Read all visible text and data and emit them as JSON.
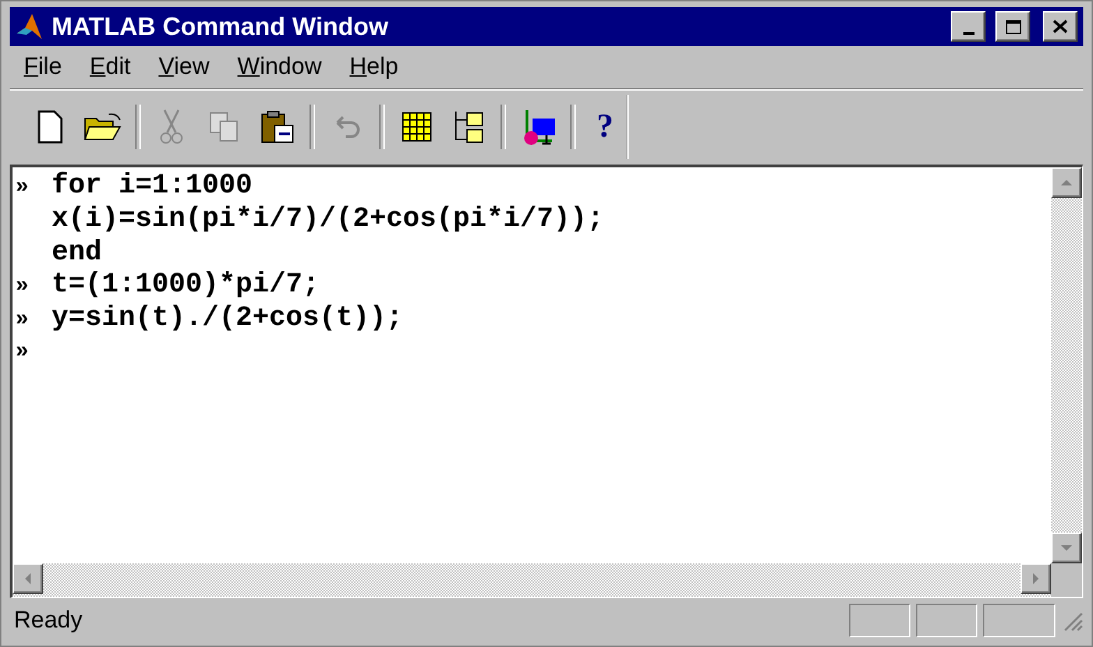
{
  "window": {
    "title": "MATLAB Command Window"
  },
  "menu": [
    "File",
    "Edit",
    "View",
    "Window",
    "Help"
  ],
  "toolbar": [
    {
      "kind": "new",
      "disabled": false
    },
    {
      "kind": "open",
      "disabled": false
    },
    {
      "kind": "separator"
    },
    {
      "kind": "cut",
      "disabled": true
    },
    {
      "kind": "copy",
      "disabled": true
    },
    {
      "kind": "paste",
      "disabled": false
    },
    {
      "kind": "separator"
    },
    {
      "kind": "undo",
      "disabled": true
    },
    {
      "kind": "separator"
    },
    {
      "kind": "workspace",
      "disabled": false
    },
    {
      "kind": "path",
      "disabled": false
    },
    {
      "kind": "separator"
    },
    {
      "kind": "simulink",
      "disabled": false
    },
    {
      "kind": "separator"
    },
    {
      "kind": "help",
      "label": "?",
      "disabled": false
    }
  ],
  "console": [
    {
      "prompt": "»",
      "code": "for i=1:1000"
    },
    {
      "code": "x(i)=sin(pi*i/7)/(2+cos(pi*i/7));"
    },
    {
      "code": "end"
    },
    {
      "prompt": "»",
      "code": "t=(1:1000)*pi/7;"
    },
    {
      "prompt": "»",
      "code": "y=sin(t)./(2+cos(t));"
    },
    {
      "prompt": "»"
    }
  ],
  "status_bar": {
    "text": "Ready"
  }
}
